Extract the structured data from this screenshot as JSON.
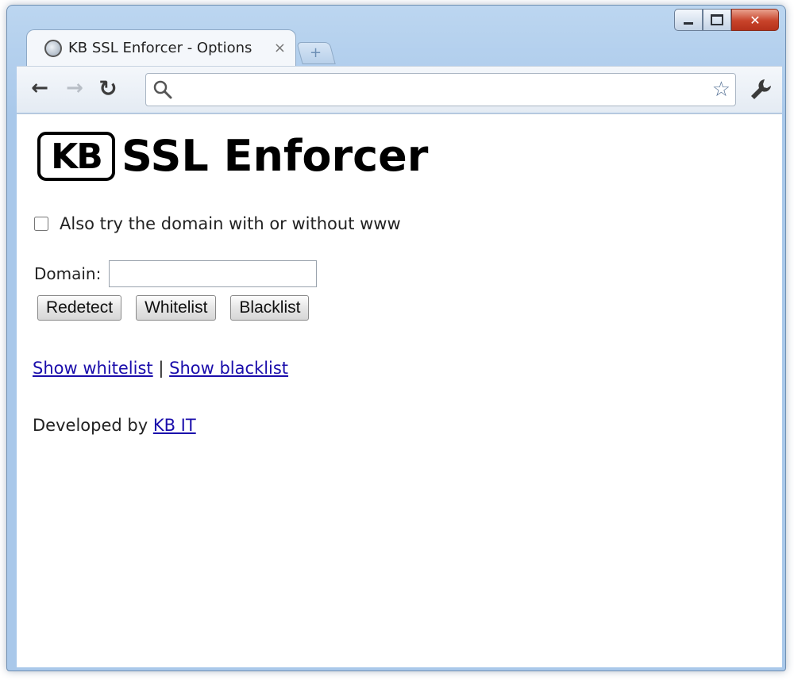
{
  "window": {
    "controls": {
      "minimize": "minimize",
      "maximize": "maximize",
      "close": "close"
    }
  },
  "tab": {
    "title": "KB SSL Enforcer - Options",
    "close_glyph": "×"
  },
  "newtab": {
    "glyph": "+"
  },
  "toolbar": {
    "back_glyph": "←",
    "forward_glyph": "→",
    "reload_glyph": "↻",
    "omnibox_value": "",
    "star_glyph": "☆"
  },
  "page": {
    "logo_mark": "KB",
    "logo_text": "SSL Enforcer",
    "www_option_label": "Also try the domain with or without www",
    "www_option_checked": false,
    "domain_label": "Domain:",
    "domain_value": "",
    "buttons": {
      "redetect": "Redetect",
      "whitelist": "Whitelist",
      "blacklist": "Blacklist"
    },
    "links": {
      "show_whitelist": "Show whitelist",
      "separator": "|",
      "show_blacklist": "Show blacklist"
    },
    "credit_prefix": "Developed by",
    "credit_link": "KB IT"
  }
}
